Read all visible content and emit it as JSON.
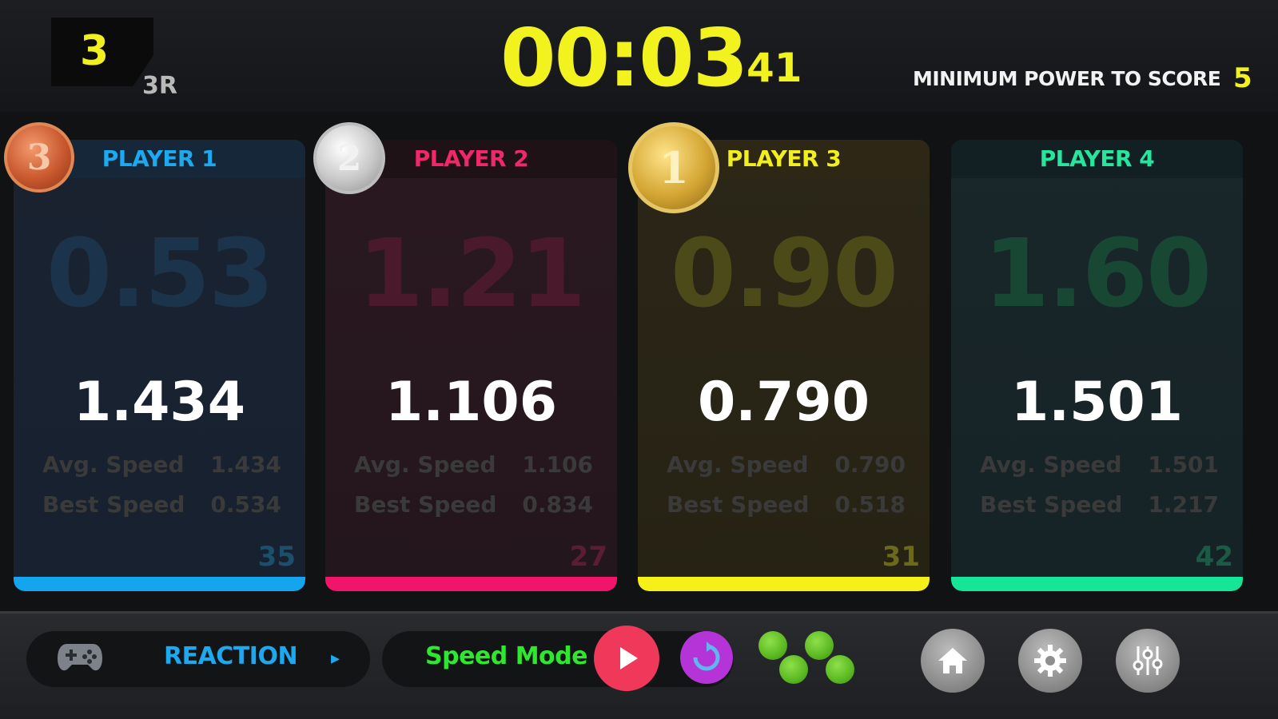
{
  "header": {
    "round_number": "3",
    "round_sub": "3R",
    "timer": "00:03",
    "timer_fraction": "41",
    "min_power_label": "MINIMUM POWER TO SCORE",
    "min_power_value": "5"
  },
  "players": [
    {
      "name": "PLAYER 1",
      "ghost": "0.53",
      "main": "1.434",
      "avg_label": "Avg. Speed",
      "avg_value": "1.434",
      "best_label": "Best Speed",
      "best_value": "0.534",
      "hits": "35",
      "color": "#13a5ee",
      "medal": "3"
    },
    {
      "name": "PLAYER 2",
      "ghost": "1.21",
      "main": "1.106",
      "avg_label": "Avg. Speed",
      "avg_value": "1.106",
      "best_label": "Best Speed",
      "best_value": "0.834",
      "hits": "27",
      "color": "#f0156a",
      "medal": "2"
    },
    {
      "name": "PLAYER 3",
      "ghost": "0.90",
      "main": "0.790",
      "avg_label": "Avg. Speed",
      "avg_value": "0.790",
      "best_label": "Best Speed",
      "best_value": "0.518",
      "hits": "31",
      "color": "#f5f018",
      "medal": "1"
    },
    {
      "name": "PLAYER 4",
      "ghost": "1.60",
      "main": "1.501",
      "avg_label": "Avg. Speed",
      "avg_value": "1.501",
      "best_label": "Best Speed",
      "best_value": "1.217",
      "hits": "42",
      "color": "#14e596",
      "medal": ""
    }
  ],
  "footer": {
    "mode_label": "REACTION",
    "mode_arrow": "▸",
    "speed_mode_label": "Speed Mode",
    "icons": [
      "gamepad-icon",
      "play-icon",
      "restart-icon",
      "dots-icon",
      "home-icon",
      "gear-icon",
      "sliders-icon"
    ]
  }
}
